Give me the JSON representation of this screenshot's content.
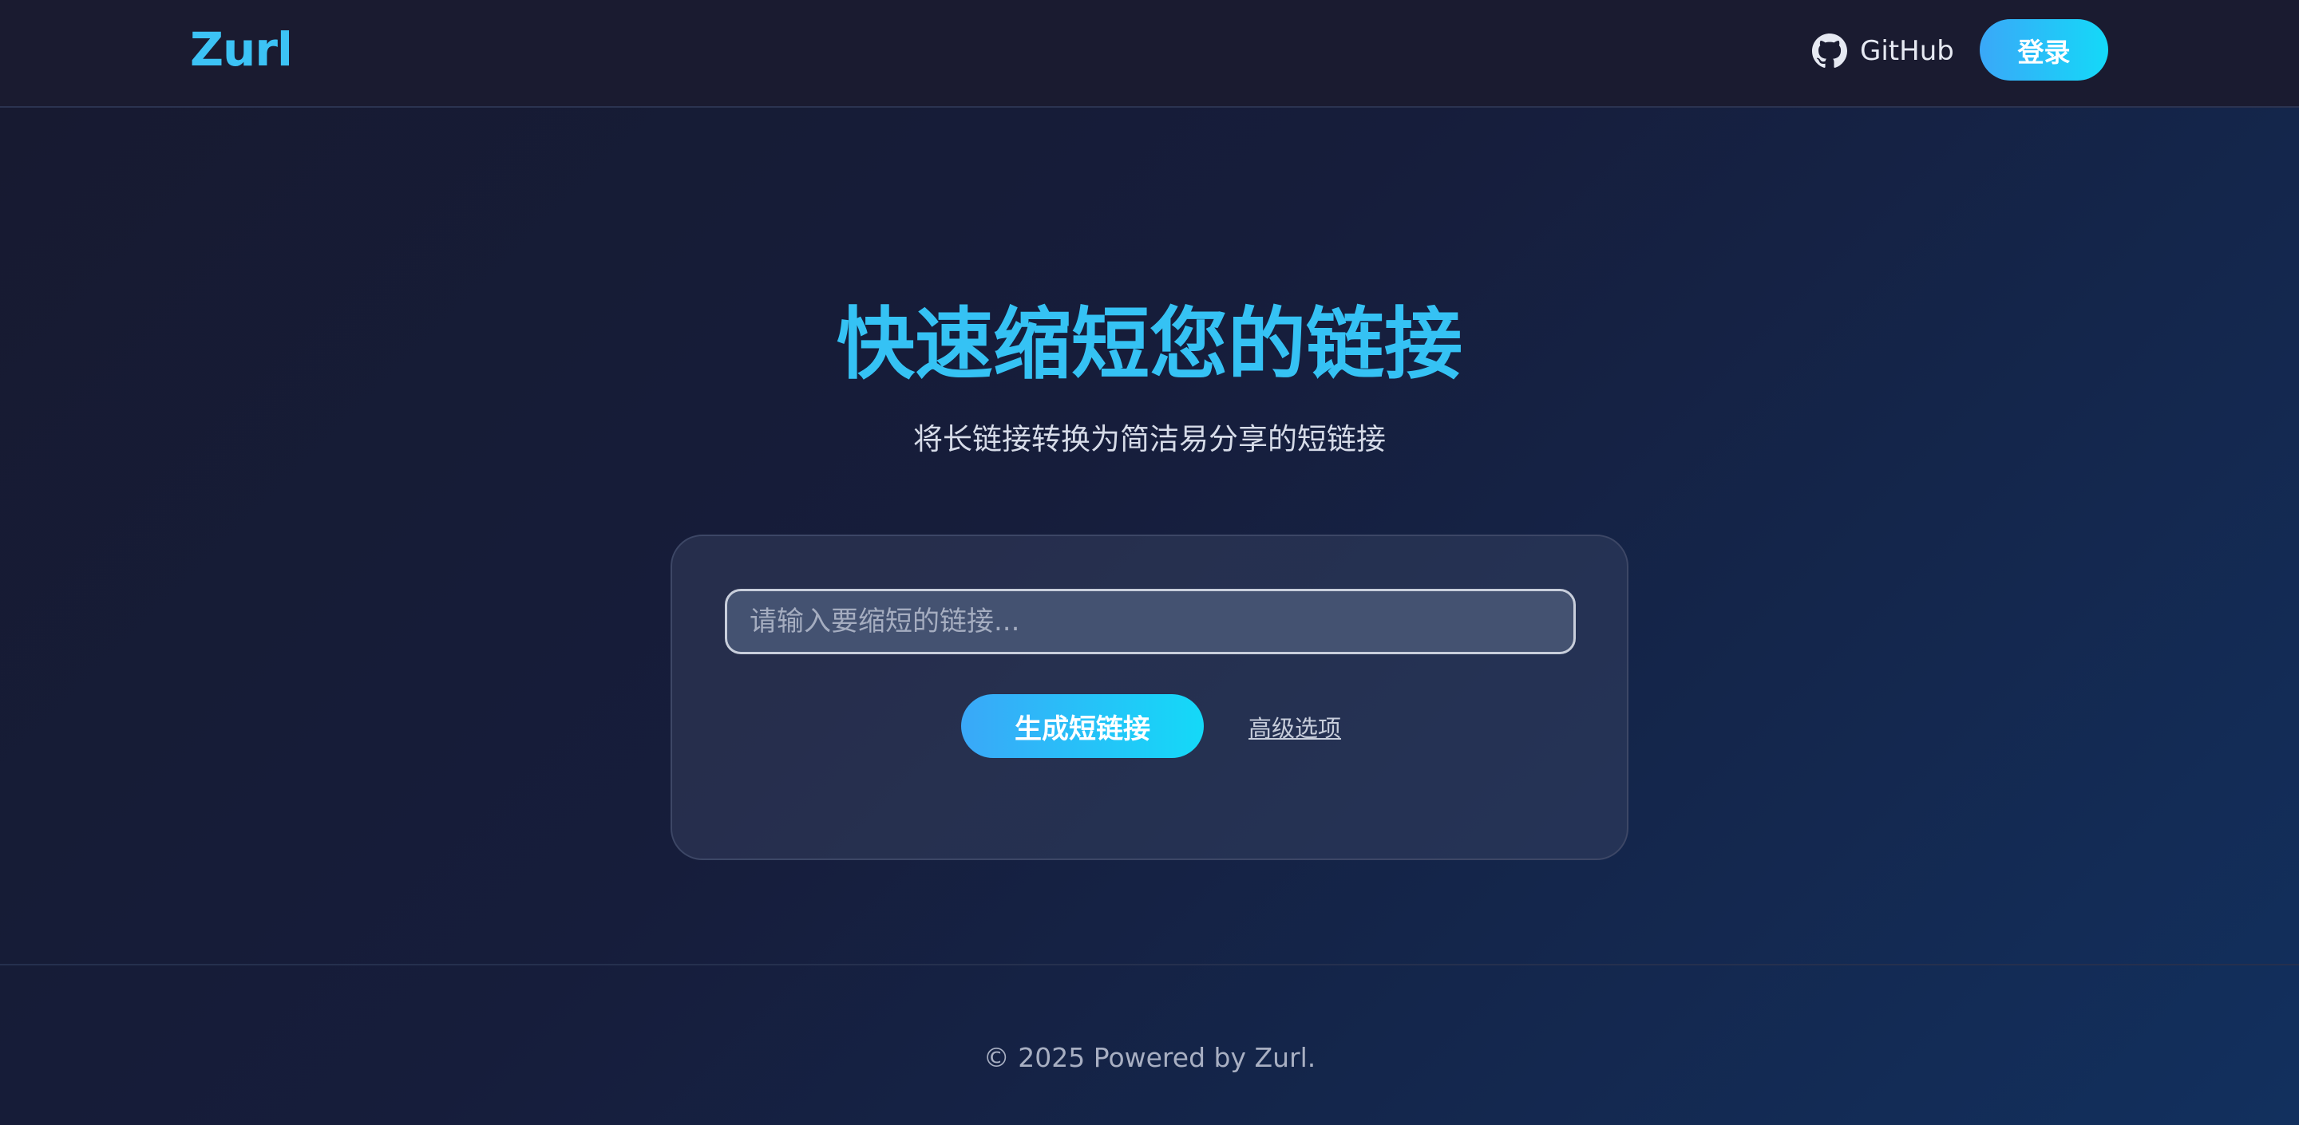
{
  "header": {
    "logo": "Zurl",
    "github_label": "GitHub",
    "login_label": "登录"
  },
  "hero": {
    "title": "快速缩短您的链接",
    "subtitle": "将长链接转换为简洁易分享的短链接"
  },
  "form": {
    "url_placeholder": "请输入要缩短的链接...",
    "url_value": "",
    "generate_label": "生成短链接",
    "advanced_label": "高级选项"
  },
  "footer": {
    "text": "© 2025 Powered by Zurl."
  },
  "icons": {
    "github": "github-icon"
  },
  "colors": {
    "accent": "#3cc3f5",
    "button_gradient_start": "#3aa8f8",
    "button_gradient_end": "#14d9f8",
    "background": "#161d3b"
  }
}
